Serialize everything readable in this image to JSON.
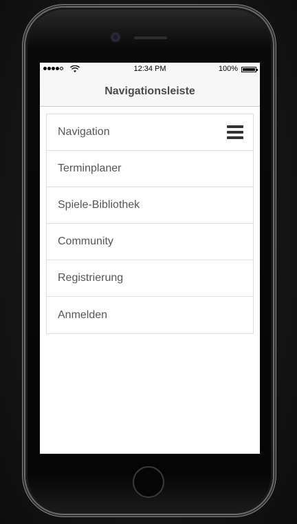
{
  "status_bar": {
    "time": "12:34 PM",
    "battery": "100%"
  },
  "nav_bar": {
    "title": "Navigationsleiste"
  },
  "menu": {
    "items": [
      {
        "label": "Navigation",
        "icon": "hamburger-icon"
      },
      {
        "label": "Terminplaner"
      },
      {
        "label": "Spiele-Bibliothek"
      },
      {
        "label": "Community"
      },
      {
        "label": "Registrierung"
      },
      {
        "label": "Anmelden"
      }
    ]
  },
  "colors": {
    "background": "#151515",
    "screen": "#ffffff",
    "nav_bar": "#f7f7f7",
    "text": "#555555",
    "title_text": "#4a4a4a",
    "border": "#dcdcdc"
  }
}
